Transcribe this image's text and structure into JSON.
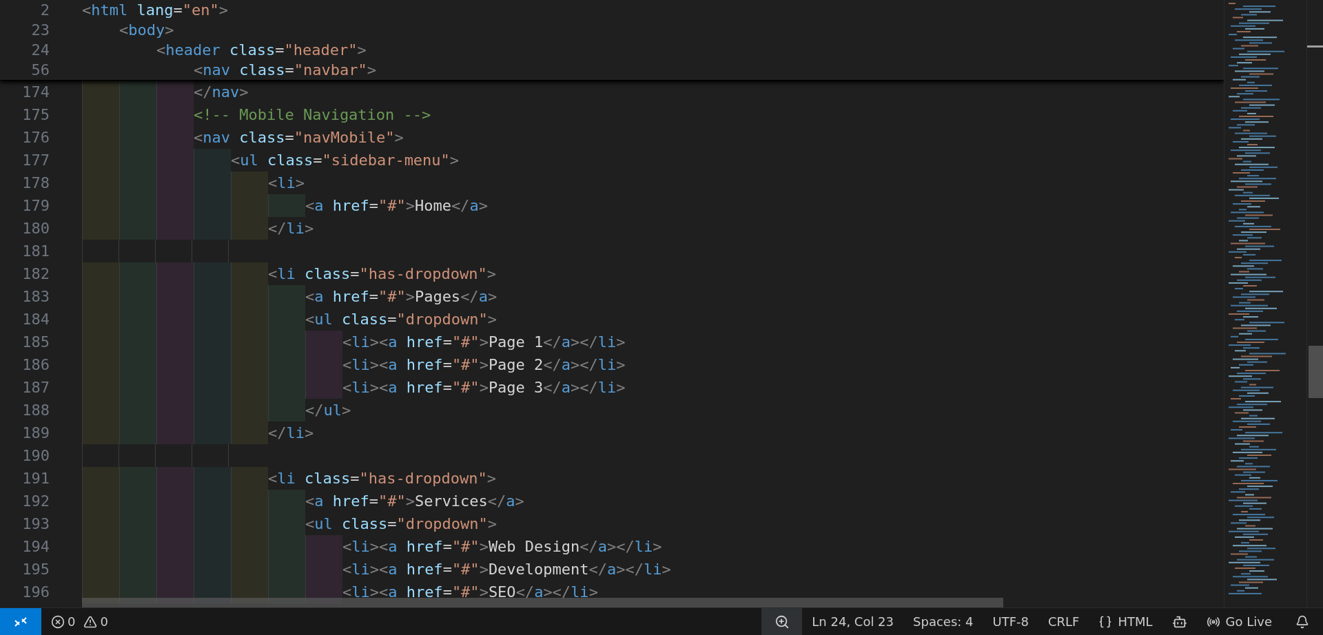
{
  "editor": {
    "sticky_scroll": {
      "lines": [
        {
          "number": "2",
          "tokens": [
            {
              "kind": "punct",
              "text": "<"
            },
            {
              "kind": "tag",
              "text": "html"
            },
            {
              "kind": "attr",
              "text": " lang"
            },
            {
              "kind": "operator",
              "text": "="
            },
            {
              "kind": "string",
              "text": "\"en\""
            },
            {
              "kind": "punct",
              "text": ">"
            }
          ]
        },
        {
          "number": "23",
          "tokens": [
            {
              "kind": "punct",
              "text": "    <"
            },
            {
              "kind": "tag",
              "text": "body"
            },
            {
              "kind": "punct",
              "text": ">"
            }
          ]
        },
        {
          "number": "24",
          "tokens": [
            {
              "kind": "punct",
              "text": "        <"
            },
            {
              "kind": "tag",
              "text": "header"
            },
            {
              "kind": "attr",
              "text": " class"
            },
            {
              "kind": "operator",
              "text": "="
            },
            {
              "kind": "string",
              "text": "\"header\""
            },
            {
              "kind": "punct",
              "text": ">"
            }
          ]
        }
      ],
      "overlapped_line": {
        "number": "56",
        "tokens": [
          {
            "kind": "punct",
            "text": "            <"
          },
          {
            "kind": "tag",
            "text": "nav"
          },
          {
            "kind": "attr",
            "text": " class"
          },
          {
            "kind": "operator",
            "text": "="
          },
          {
            "kind": "string",
            "text": "\"navbar\""
          },
          {
            "kind": "punct",
            "text": ">"
          }
        ]
      }
    },
    "lines": [
      {
        "number": "174",
        "tokens": [
          {
            "kind": "punct",
            "text": "            </"
          },
          {
            "kind": "tag",
            "text": "nav"
          },
          {
            "kind": "punct",
            "text": ">"
          }
        ]
      },
      {
        "number": "175",
        "tokens": [
          {
            "kind": "comment",
            "text": "            <!-- Mobile Navigation -->"
          }
        ]
      },
      {
        "number": "176",
        "tokens": [
          {
            "kind": "punct",
            "text": "            <"
          },
          {
            "kind": "tag",
            "text": "nav"
          },
          {
            "kind": "attr",
            "text": " class"
          },
          {
            "kind": "operator",
            "text": "="
          },
          {
            "kind": "string",
            "text": "\"navMobile\""
          },
          {
            "kind": "punct",
            "text": ">"
          }
        ]
      },
      {
        "number": "177",
        "tokens": [
          {
            "kind": "punct",
            "text": "                <"
          },
          {
            "kind": "tag",
            "text": "ul"
          },
          {
            "kind": "attr",
            "text": " class"
          },
          {
            "kind": "operator",
            "text": "="
          },
          {
            "kind": "string",
            "text": "\"sidebar-menu\""
          },
          {
            "kind": "punct",
            "text": ">"
          }
        ]
      },
      {
        "number": "178",
        "tokens": [
          {
            "kind": "punct",
            "text": "                    <"
          },
          {
            "kind": "tag",
            "text": "li"
          },
          {
            "kind": "punct",
            "text": ">"
          }
        ]
      },
      {
        "number": "179",
        "tokens": [
          {
            "kind": "punct",
            "text": "                        <"
          },
          {
            "kind": "tag",
            "text": "a"
          },
          {
            "kind": "attr",
            "text": " href"
          },
          {
            "kind": "operator",
            "text": "="
          },
          {
            "kind": "string",
            "text": "\"#\""
          },
          {
            "kind": "punct",
            "text": ">"
          },
          {
            "kind": "text",
            "text": "Home"
          },
          {
            "kind": "punct",
            "text": "</"
          },
          {
            "kind": "tag",
            "text": "a"
          },
          {
            "kind": "punct",
            "text": ">"
          }
        ]
      },
      {
        "number": "180",
        "tokens": [
          {
            "kind": "punct",
            "text": "                    </"
          },
          {
            "kind": "tag",
            "text": "li"
          },
          {
            "kind": "punct",
            "text": ">"
          }
        ]
      },
      {
        "number": "181"
      },
      {
        "number": "182",
        "tokens": [
          {
            "kind": "punct",
            "text": "                    <"
          },
          {
            "kind": "tag",
            "text": "li"
          },
          {
            "kind": "attr",
            "text": " class"
          },
          {
            "kind": "operator",
            "text": "="
          },
          {
            "kind": "string",
            "text": "\"has-dropdown\""
          },
          {
            "kind": "punct",
            "text": ">"
          }
        ]
      },
      {
        "number": "183",
        "tokens": [
          {
            "kind": "punct",
            "text": "                        <"
          },
          {
            "kind": "tag",
            "text": "a"
          },
          {
            "kind": "attr",
            "text": " href"
          },
          {
            "kind": "operator",
            "text": "="
          },
          {
            "kind": "string",
            "text": "\"#\""
          },
          {
            "kind": "punct",
            "text": ">"
          },
          {
            "kind": "text",
            "text": "Pages"
          },
          {
            "kind": "punct",
            "text": "</"
          },
          {
            "kind": "tag",
            "text": "a"
          },
          {
            "kind": "punct",
            "text": ">"
          }
        ]
      },
      {
        "number": "184",
        "tokens": [
          {
            "kind": "punct",
            "text": "                        <"
          },
          {
            "kind": "tag",
            "text": "ul"
          },
          {
            "kind": "attr",
            "text": " class"
          },
          {
            "kind": "operator",
            "text": "="
          },
          {
            "kind": "string",
            "text": "\"dropdown\""
          },
          {
            "kind": "punct",
            "text": ">"
          }
        ]
      },
      {
        "number": "185",
        "tokens": [
          {
            "kind": "punct",
            "text": "                            <"
          },
          {
            "kind": "tag",
            "text": "li"
          },
          {
            "kind": "punct",
            "text": "><"
          },
          {
            "kind": "tag",
            "text": "a"
          },
          {
            "kind": "attr",
            "text": " href"
          },
          {
            "kind": "operator",
            "text": "="
          },
          {
            "kind": "string",
            "text": "\"#\""
          },
          {
            "kind": "punct",
            "text": ">"
          },
          {
            "kind": "text",
            "text": "Page 1"
          },
          {
            "kind": "punct",
            "text": "</"
          },
          {
            "kind": "tag",
            "text": "a"
          },
          {
            "kind": "punct",
            "text": "></"
          },
          {
            "kind": "tag",
            "text": "li"
          },
          {
            "kind": "punct",
            "text": ">"
          }
        ]
      },
      {
        "number": "186",
        "tokens": [
          {
            "kind": "punct",
            "text": "                            <"
          },
          {
            "kind": "tag",
            "text": "li"
          },
          {
            "kind": "punct",
            "text": "><"
          },
          {
            "kind": "tag",
            "text": "a"
          },
          {
            "kind": "attr",
            "text": " href"
          },
          {
            "kind": "operator",
            "text": "="
          },
          {
            "kind": "string",
            "text": "\"#\""
          },
          {
            "kind": "punct",
            "text": ">"
          },
          {
            "kind": "text",
            "text": "Page 2"
          },
          {
            "kind": "punct",
            "text": "</"
          },
          {
            "kind": "tag",
            "text": "a"
          },
          {
            "kind": "punct",
            "text": "></"
          },
          {
            "kind": "tag",
            "text": "li"
          },
          {
            "kind": "punct",
            "text": ">"
          }
        ]
      },
      {
        "number": "187",
        "tokens": [
          {
            "kind": "punct",
            "text": "                            <"
          },
          {
            "kind": "tag",
            "text": "li"
          },
          {
            "kind": "punct",
            "text": "><"
          },
          {
            "kind": "tag",
            "text": "a"
          },
          {
            "kind": "attr",
            "text": " href"
          },
          {
            "kind": "operator",
            "text": "="
          },
          {
            "kind": "string",
            "text": "\"#\""
          },
          {
            "kind": "punct",
            "text": ">"
          },
          {
            "kind": "text",
            "text": "Page 3"
          },
          {
            "kind": "punct",
            "text": "</"
          },
          {
            "kind": "tag",
            "text": "a"
          },
          {
            "kind": "punct",
            "text": "></"
          },
          {
            "kind": "tag",
            "text": "li"
          },
          {
            "kind": "punct",
            "text": ">"
          }
        ]
      },
      {
        "number": "188",
        "tokens": [
          {
            "kind": "punct",
            "text": "                        </"
          },
          {
            "kind": "tag",
            "text": "ul"
          },
          {
            "kind": "punct",
            "text": ">"
          }
        ]
      },
      {
        "number": "189",
        "tokens": [
          {
            "kind": "punct",
            "text": "                    </"
          },
          {
            "kind": "tag",
            "text": "li"
          },
          {
            "kind": "punct",
            "text": ">"
          }
        ]
      },
      {
        "number": "190"
      },
      {
        "number": "191",
        "tokens": [
          {
            "kind": "punct",
            "text": "                    <"
          },
          {
            "kind": "tag",
            "text": "li"
          },
          {
            "kind": "attr",
            "text": " class"
          },
          {
            "kind": "operator",
            "text": "="
          },
          {
            "kind": "string",
            "text": "\"has-dropdown\""
          },
          {
            "kind": "punct",
            "text": ">"
          }
        ]
      },
      {
        "number": "192",
        "tokens": [
          {
            "kind": "punct",
            "text": "                        <"
          },
          {
            "kind": "tag",
            "text": "a"
          },
          {
            "kind": "attr",
            "text": " href"
          },
          {
            "kind": "operator",
            "text": "="
          },
          {
            "kind": "string",
            "text": "\"#\""
          },
          {
            "kind": "punct",
            "text": ">"
          },
          {
            "kind": "text",
            "text": "Services"
          },
          {
            "kind": "punct",
            "text": "</"
          },
          {
            "kind": "tag",
            "text": "a"
          },
          {
            "kind": "punct",
            "text": ">"
          }
        ]
      },
      {
        "number": "193",
        "tokens": [
          {
            "kind": "punct",
            "text": "                        <"
          },
          {
            "kind": "tag",
            "text": "ul"
          },
          {
            "kind": "attr",
            "text": " class"
          },
          {
            "kind": "operator",
            "text": "="
          },
          {
            "kind": "string",
            "text": "\"dropdown\""
          },
          {
            "kind": "punct",
            "text": ">"
          }
        ]
      },
      {
        "number": "194",
        "tokens": [
          {
            "kind": "punct",
            "text": "                            <"
          },
          {
            "kind": "tag",
            "text": "li"
          },
          {
            "kind": "punct",
            "text": "><"
          },
          {
            "kind": "tag",
            "text": "a"
          },
          {
            "kind": "attr",
            "text": " href"
          },
          {
            "kind": "operator",
            "text": "="
          },
          {
            "kind": "string",
            "text": "\"#\""
          },
          {
            "kind": "punct",
            "text": ">"
          },
          {
            "kind": "text",
            "text": "Web Design"
          },
          {
            "kind": "punct",
            "text": "</"
          },
          {
            "kind": "tag",
            "text": "a"
          },
          {
            "kind": "punct",
            "text": "></"
          },
          {
            "kind": "tag",
            "text": "li"
          },
          {
            "kind": "punct",
            "text": ">"
          }
        ]
      },
      {
        "number": "195",
        "tokens": [
          {
            "kind": "punct",
            "text": "                            <"
          },
          {
            "kind": "tag",
            "text": "li"
          },
          {
            "kind": "punct",
            "text": "><"
          },
          {
            "kind": "tag",
            "text": "a"
          },
          {
            "kind": "attr",
            "text": " href"
          },
          {
            "kind": "operator",
            "text": "="
          },
          {
            "kind": "string",
            "text": "\"#\""
          },
          {
            "kind": "punct",
            "text": ">"
          },
          {
            "kind": "text",
            "text": "Development"
          },
          {
            "kind": "punct",
            "text": "</"
          },
          {
            "kind": "tag",
            "text": "a"
          },
          {
            "kind": "punct",
            "text": "></"
          },
          {
            "kind": "tag",
            "text": "li"
          },
          {
            "kind": "punct",
            "text": ">"
          }
        ]
      },
      {
        "number": "196",
        "tokens": [
          {
            "kind": "punct",
            "text": "                            <"
          },
          {
            "kind": "tag",
            "text": "li"
          },
          {
            "kind": "punct",
            "text": "><"
          },
          {
            "kind": "tag",
            "text": "a"
          },
          {
            "kind": "attr",
            "text": " href"
          },
          {
            "kind": "operator",
            "text": "="
          },
          {
            "kind": "string",
            "text": "\"#\""
          },
          {
            "kind": "punct",
            "text": ">"
          },
          {
            "kind": "text",
            "text": "SEO"
          },
          {
            "kind": "punct",
            "text": "</"
          },
          {
            "kind": "tag",
            "text": "a"
          },
          {
            "kind": "punct",
            "text": "></"
          },
          {
            "kind": "tag",
            "text": "li"
          },
          {
            "kind": "punct",
            "text": ">"
          }
        ]
      }
    ]
  },
  "status_bar": {
    "problems": {
      "errors": "0",
      "warnings": "0"
    },
    "cursor_position": "Ln 24, Col 23",
    "indentation": "Spaces: 4",
    "encoding": "UTF-8",
    "line_ending": "CRLF",
    "language": "HTML",
    "live_server": "Go Live"
  }
}
